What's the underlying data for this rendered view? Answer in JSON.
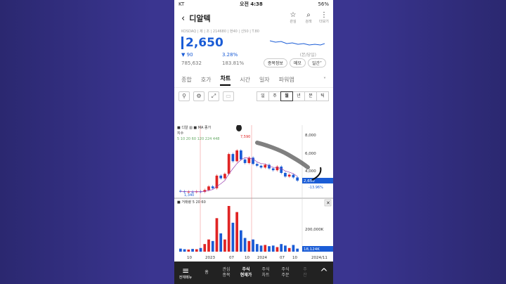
{
  "status_bar": {
    "carrier": "KT",
    "time": "오전 4:38",
    "battery": "56%"
  },
  "header": {
    "title": "디알텍",
    "icons": [
      {
        "name": "star-icon",
        "label": "관심"
      },
      {
        "name": "search-icon",
        "label": "검색"
      },
      {
        "name": "more-icon",
        "label": "더보기"
      }
    ]
  },
  "stock": {
    "meta": "KOSDAQ | 제 | 조 | 214680 | 현40 | 신50 | T.80",
    "price": "2,650",
    "change": "90",
    "change_pct": "3.28%",
    "volume": "785,632",
    "volume_pct": "183.81%",
    "spark_label": "(본/당일)",
    "buttons": [
      "종목정보",
      "메모",
      "일간˅"
    ]
  },
  "tabs": {
    "items": [
      "종합",
      "호가",
      "차트",
      "시간",
      "일자",
      "파워앱"
    ],
    "active": "차트",
    "more": "˅"
  },
  "toolbar": {
    "tools": [
      "⚲",
      "⚙",
      "⤢",
      "▭"
    ],
    "periods": [
      "일",
      "주",
      "월",
      "년",
      "분",
      "틱"
    ],
    "selected_period": "월"
  },
  "chart": {
    "legend_top": "■ 디알 ▥ ■ MA 종가",
    "legend_sub": "지수",
    "ma_legend": "5 10 20 60 120 224 448",
    "y_axis": [
      "8,000",
      "6,000",
      "4,000"
    ],
    "high_label": "7,590",
    "low_label": "1,340",
    "current_price": "2,650",
    "current_pct": "-13.96%",
    "volume_legend": "■ 거래량 5 20 60",
    "volume_axis": "200,000K",
    "current_volume": "18,124K",
    "x_axis": [
      "10",
      "2023",
      "07",
      "10",
      "2024",
      "07",
      "10",
      "2024/11"
    ]
  },
  "bottom_nav": {
    "menu_label": "전체메뉴",
    "items": [
      "홈",
      "관심\n종목",
      "주식\n현재가",
      "주식\n차트",
      "주식\n주문",
      "주\n잔"
    ],
    "active": "주식\n현재가"
  },
  "colors": {
    "up": "#e02424",
    "down": "#1a5cd6",
    "background": "#3a3590"
  },
  "chart_data": {
    "type": "candlestick",
    "candles": [
      {
        "o": 1500,
        "c": 1450,
        "up": false
      },
      {
        "o": 1450,
        "c": 1400,
        "up": false
      },
      {
        "o": 1400,
        "c": 1420,
        "up": true
      },
      {
        "o": 1420,
        "c": 1380,
        "up": false
      },
      {
        "o": 1380,
        "c": 1450,
        "up": true
      },
      {
        "o": 1450,
        "c": 1400,
        "up": false
      },
      {
        "o": 1400,
        "c": 1600,
        "up": true
      },
      {
        "o": 1600,
        "c": 2000,
        "up": true
      },
      {
        "o": 2000,
        "c": 1800,
        "up": false
      },
      {
        "o": 1800,
        "c": 3200,
        "up": true
      },
      {
        "o": 3200,
        "c": 2900,
        "up": false
      },
      {
        "o": 2900,
        "c": 3400,
        "up": true
      },
      {
        "o": 3400,
        "c": 5600,
        "up": true
      },
      {
        "o": 5600,
        "c": 4800,
        "up": false
      },
      {
        "o": 4800,
        "c": 6000,
        "up": true
      },
      {
        "o": 6000,
        "c": 5000,
        "up": false
      },
      {
        "o": 5000,
        "c": 4600,
        "up": false
      },
      {
        "o": 4600,
        "c": 5200,
        "up": true
      },
      {
        "o": 5200,
        "c": 4500,
        "up": false
      },
      {
        "o": 4500,
        "c": 4300,
        "up": false
      },
      {
        "o": 4300,
        "c": 4100,
        "up": false
      },
      {
        "o": 4100,
        "c": 4400,
        "up": true
      },
      {
        "o": 4400,
        "c": 4000,
        "up": false
      },
      {
        "o": 4000,
        "c": 3800,
        "up": false
      },
      {
        "o": 3800,
        "c": 4200,
        "up": true
      },
      {
        "o": 4200,
        "c": 3500,
        "up": false
      },
      {
        "o": 3500,
        "c": 3100,
        "up": false
      },
      {
        "o": 3100,
        "c": 3300,
        "up": true
      },
      {
        "o": 3300,
        "c": 3000,
        "up": false
      },
      {
        "o": 3000,
        "c": 2650,
        "up": false
      }
    ],
    "volumes": [
      10,
      8,
      7,
      9,
      8,
      12,
      25,
      40,
      35,
      110,
      60,
      40,
      150,
      95,
      130,
      70,
      45,
      35,
      40,
      25,
      20,
      22,
      18,
      20,
      15,
      25,
      20,
      12,
      22,
      10
    ],
    "ylim": [
      1000,
      8500
    ],
    "x": [
      "10",
      "2023",
      "07",
      "10",
      "2024",
      "07",
      "10",
      "2024/11"
    ]
  }
}
